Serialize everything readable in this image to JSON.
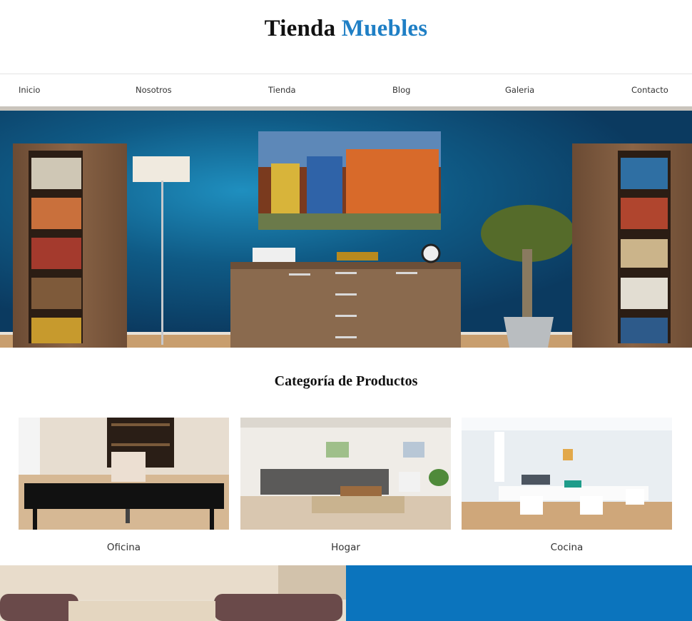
{
  "header": {
    "brand_part1": "Tienda",
    "brand_part2": "Muebles"
  },
  "nav": {
    "items": [
      {
        "label": "Inicio"
      },
      {
        "label": "Nosotros"
      },
      {
        "label": "Tienda"
      },
      {
        "label": "Blog"
      },
      {
        "label": "Galeria"
      },
      {
        "label": "Contacto"
      }
    ]
  },
  "hero": {
    "image": "living-room-blue-wall-photo"
  },
  "categories": {
    "title": "Categoría de Productos",
    "items": [
      {
        "label": "Oficina",
        "image": "office-photo"
      },
      {
        "label": "Hogar",
        "image": "living-room-photo"
      },
      {
        "label": "Cocina",
        "image": "white-dining-room-photo"
      }
    ]
  },
  "colors": {
    "accent": "#1f7fc5",
    "band_blue": "#0b74bd",
    "hero_wall": "#0c3f66"
  }
}
